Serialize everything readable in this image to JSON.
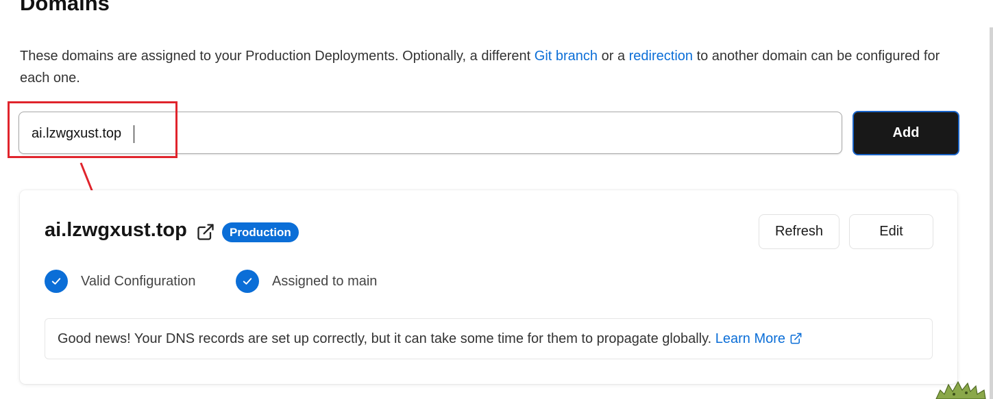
{
  "page": {
    "title": "Domains",
    "intro": {
      "before": "These domains are assigned to your Production Deployments. Optionally, a different ",
      "link1": "Git branch",
      "middle": " or a ",
      "link2": "redirection",
      "after": " to another domain can be configured for each one."
    }
  },
  "add_form": {
    "input_value": "ai.lzwgxust.top",
    "button_label": "Add"
  },
  "domain_card": {
    "domain": "ai.lzwgxust.top",
    "badge": "Production",
    "refresh_label": "Refresh",
    "edit_label": "Edit",
    "statuses": [
      {
        "label": "Valid Configuration",
        "icon": "check-circle-icon"
      },
      {
        "label": "Assigned to main",
        "icon": "check-circle-icon"
      }
    ],
    "notice": {
      "text": "Good news! Your DNS records are set up correctly, but it can take some time for them to propagate globally. ",
      "link": "Learn More"
    }
  },
  "colors": {
    "accent": "#0b6ed7",
    "annotation": "#e0242c",
    "add_button_bg": "#181818"
  }
}
